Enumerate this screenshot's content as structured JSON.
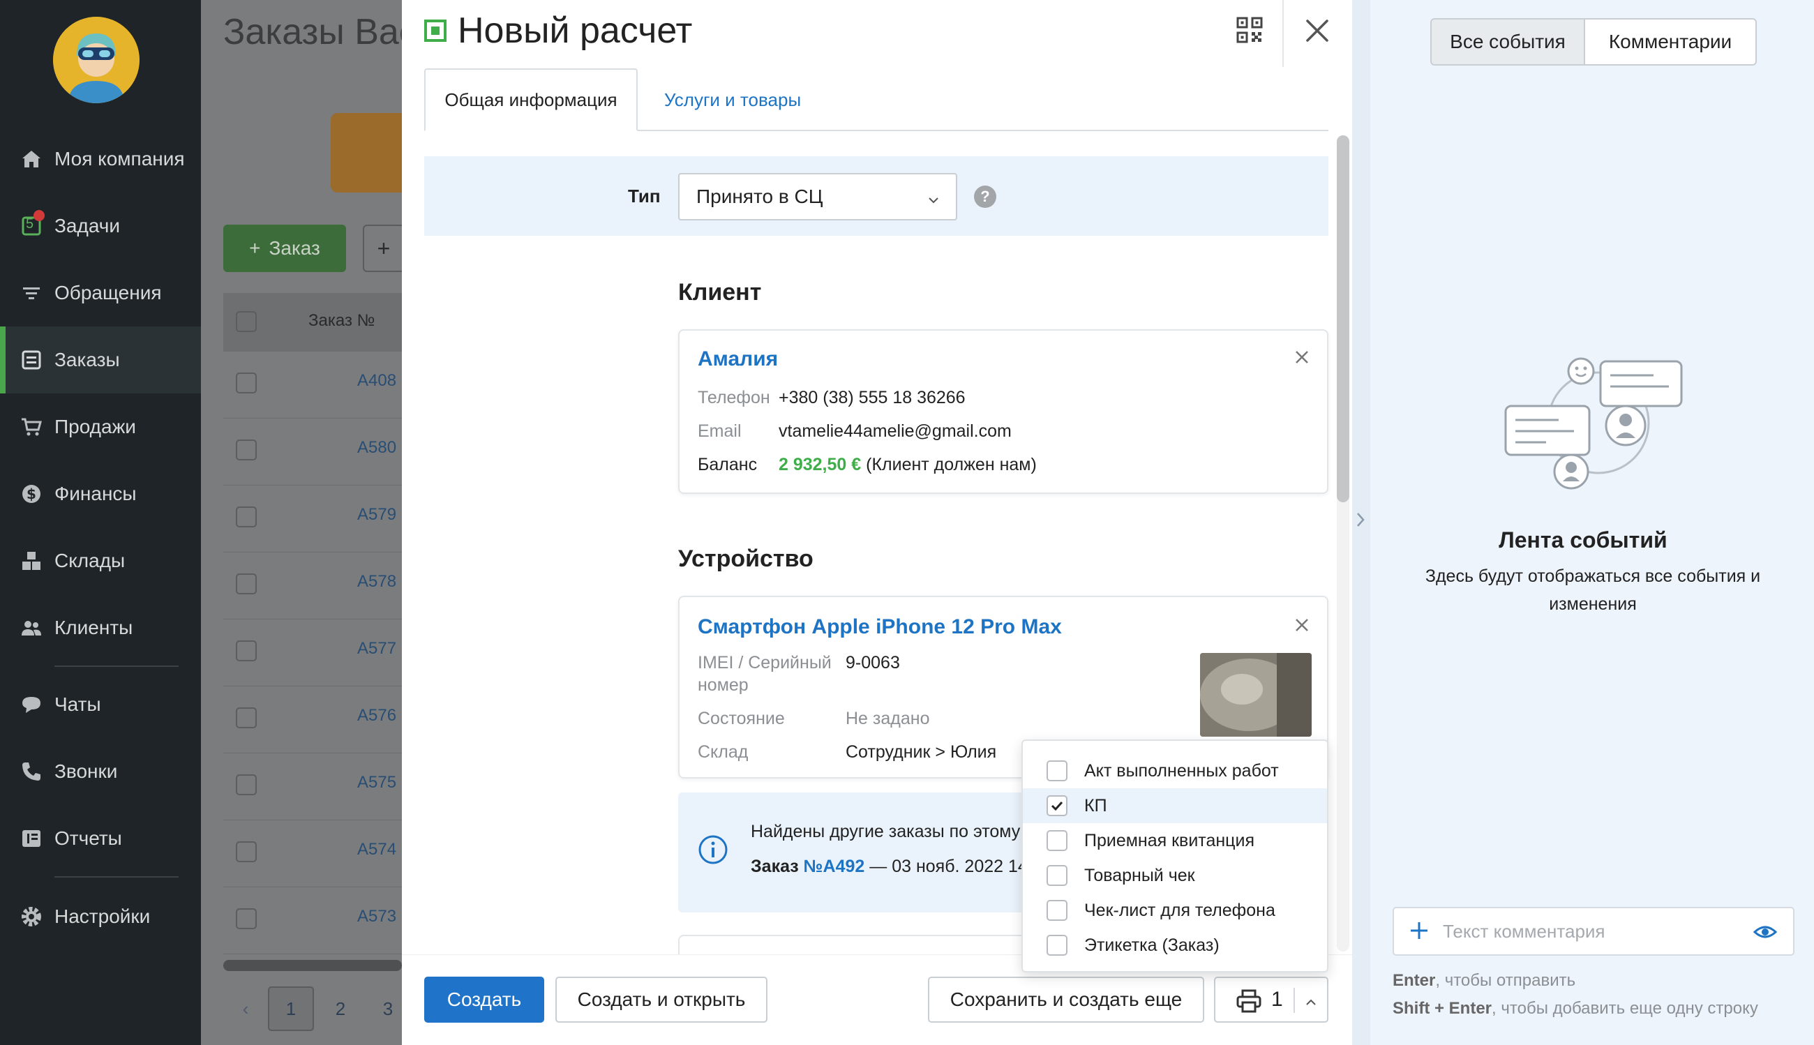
{
  "sidebar": {
    "items": [
      {
        "label": "Моя компания",
        "icon": "home-icon"
      },
      {
        "label": "Задачи",
        "icon": "tasks-icon",
        "badge": "5"
      },
      {
        "label": "Обращения",
        "icon": "filter-icon"
      },
      {
        "label": "Заказы",
        "icon": "orders-icon",
        "active": true
      },
      {
        "label": "Продажи",
        "icon": "cart-icon"
      },
      {
        "label": "Финансы",
        "icon": "dollar-icon"
      },
      {
        "label": "Склады",
        "icon": "boxes-icon"
      },
      {
        "label": "Клиенты",
        "icon": "users-icon"
      },
      {
        "label": "Чаты",
        "icon": "chat-icon"
      },
      {
        "label": "Звонки",
        "icon": "phone-icon"
      },
      {
        "label": "Отчеты",
        "icon": "reports-icon"
      },
      {
        "label": "Настройки",
        "icon": "gear-icon"
      }
    ]
  },
  "background": {
    "title": "Заказы Вас",
    "order_button": "Заказ",
    "plus_button": "+",
    "column_order": "Заказ №",
    "rows": [
      "A408",
      "A580",
      "A579",
      "A578",
      "A577",
      "A576",
      "A575",
      "A574",
      "A573"
    ],
    "pages": [
      "1",
      "2",
      "3"
    ]
  },
  "modal": {
    "title": "Новый расчет",
    "tabs": {
      "general": "Общая информация",
      "services": "Услуги и товары"
    },
    "type": {
      "label": "Тип",
      "value": "Принято в СЦ",
      "help": "?"
    },
    "client": {
      "section": "Клиент",
      "name": "Амалия",
      "phone_label": "Телефон",
      "phone": "+380 (38) 555 18 36266",
      "email_label": "Email",
      "email": "vtamelie44amelie@gmail.com",
      "balance_label": "Баланс",
      "balance_amount": "2 932,50 €",
      "balance_note": "(Клиент должен нам)"
    },
    "device": {
      "section": "Устройство",
      "name": "Смартфон Apple iPhone 12 Pro Max",
      "imei_label_1": "IMEI / Серийный",
      "imei_label_2": "номер",
      "imei": "9-0063",
      "state_label": "Состояние",
      "state": "Не задано",
      "warehouse_label": "Склад",
      "warehouse": "Сотрудник > Юлия"
    },
    "notice": {
      "text": "Найдены другие заказы по этому",
      "order_prefix": "Заказ",
      "order_link": "№A492",
      "order_suffix": "— 03 нояб. 2022 14"
    },
    "footer": {
      "create": "Создать",
      "create_open": "Создать и открыть",
      "save_more": "Сохранить и создать еще",
      "print_count": "1"
    },
    "print_menu": [
      {
        "label": "Акт выполненных работ",
        "checked": false
      },
      {
        "label": "КП",
        "checked": true
      },
      {
        "label": "Приемная квитанция",
        "checked": false
      },
      {
        "label": "Товарный чек",
        "checked": false
      },
      {
        "label": "Чек-лист для телефона",
        "checked": false
      },
      {
        "label": "Этикетка (Заказ)",
        "checked": false
      }
    ]
  },
  "right_panel": {
    "tabs": {
      "all": "Все события",
      "comments": "Комментарии"
    },
    "feed_title": "Лента событий",
    "feed_subtitle": "Здесь будут отображаться все события и изменения",
    "comment_placeholder": "Текст комментария",
    "hint_enter_key": "Enter",
    "hint_enter_text": ", чтобы отправить",
    "hint_shift_key": "Shift + Enter",
    "hint_shift_text": ", чтобы добавить еще одну строку"
  },
  "colors": {
    "accent": "#1f73c8",
    "link": "#1e74c4",
    "success": "#3fae4a",
    "sidebar": "#1e2427",
    "balance_positive": "#3fae4a"
  }
}
